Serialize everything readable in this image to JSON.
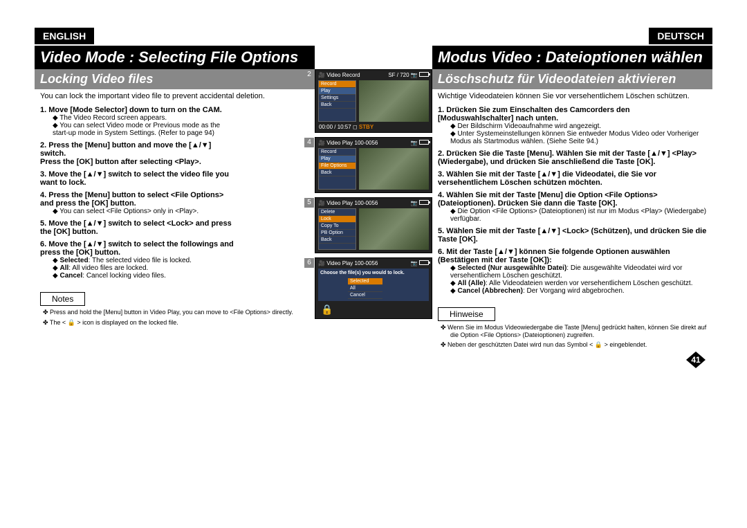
{
  "en": {
    "lang": "ENGLISH",
    "title": "Video Mode : Selecting File Options",
    "subtitle": "Locking Video files",
    "intro": "You can lock the important video file to prevent accidental deletion.",
    "steps": [
      {
        "n": "1.",
        "t": "Move [Mode Selector] down to turn on the CAM.",
        "subs": [
          "The Video Record screen appears.",
          "You can select Video mode or Previous mode as the start-up mode in System Settings. (Refer to page 94)"
        ]
      },
      {
        "n": "2.",
        "t": "Press the [Menu] button and move the [▲/▼] switch.",
        "t2": "Press the [OK] button after selecting <Play>."
      },
      {
        "n": "3.",
        "t": "Move the [▲/▼] switch to select the video file you want to lock."
      },
      {
        "n": "4.",
        "t": "Press the [Menu] button to select <File Options> and press the [OK] button.",
        "subs": [
          "You can select <File Options> only in <Play>."
        ]
      },
      {
        "n": "5.",
        "t": "Move the [▲/▼] switch to select <Lock> and press the [OK] button."
      },
      {
        "n": "6.",
        "t": "Move the [▲/▼] switch to select the followings and press the [OK] button.",
        "subs": [
          "Selected: The selected video file is locked.",
          "All: All video files are locked.",
          "Cancel: Cancel locking video files."
        ],
        "bold": [
          "Selected",
          "All",
          "Cancel"
        ]
      }
    ],
    "notes_label": "Notes",
    "notes": [
      "Press and hold the [Menu] button in Video Play, you can move to <File Options> directly.",
      "The < 🔒 > icon is displayed on the locked file."
    ]
  },
  "de": {
    "lang": "DEUTSCH",
    "title": "Modus Video : Dateioptionen wählen",
    "subtitle": "Löschschutz für Videodateien aktivieren",
    "intro": "Wichtige Videodateien können Sie vor versehentlichem Löschen schützen.",
    "steps": [
      {
        "n": "1.",
        "t": "Drücken Sie zum Einschalten des Camcorders den [Moduswahlschalter] nach unten.",
        "subs": [
          "Der Bildschirm Videoaufnahme wird angezeigt.",
          "Unter Systemeinstellungen können Sie entweder Modus Video oder Vorheriger Modus als Startmodus wählen. (Siehe Seite 94.)"
        ]
      },
      {
        "n": "2.",
        "t": "Drücken Sie die Taste [Menu]. Wählen Sie mit der Taste [▲/▼] <Play> (Wiedergabe), und drücken Sie anschließend die Taste [OK]."
      },
      {
        "n": "3.",
        "t": "Wählen Sie mit der Taste [▲/▼] die Videodatei, die Sie vor versehentlichem Löschen schützen möchten."
      },
      {
        "n": "4.",
        "t": "Wählen Sie mit der Taste [Menu] die Option <File Options> (Dateioptionen). Drücken Sie dann die Taste [OK].",
        "subs": [
          "Die Option <File Options> (Dateioptionen) ist nur im Modus <Play> (Wiedergabe) verfügbar."
        ]
      },
      {
        "n": "5.",
        "t": "Wählen Sie mit der Taste [▲/▼] <Lock> (Schützen), und drücken Sie die Taste [OK]."
      },
      {
        "n": "6.",
        "t": "Mit der Taste [▲/▼] können Sie folgende Optionen auswählen (Bestätigen mit der Taste [OK]):",
        "subs": [
          "Selected (Nur ausgewählte Datei): Die ausgewählte Videodatei wird vor versehentlichem Löschen geschützt.",
          "All (Alle): Alle Videodateien werden vor versehentlichem Löschen geschützt.",
          "Cancel (Abbrechen): Der Vorgang wird abgebrochen."
        ],
        "bold": [
          "Selected (Nur ausgewählte Datei)",
          "All (Alle)",
          "Cancel (Abbrechen)"
        ]
      }
    ],
    "notes_label": "Hinweise",
    "notes": [
      "Wenn Sie im Modus Videowiedergabe die Taste [Menu] gedrückt halten, können Sie direkt auf die Option <File Options> (Dateioptionen) zugreifen.",
      "Neben der geschützten Datei wird nun das Symbol < 🔒 > eingeblendet."
    ]
  },
  "screens": {
    "s2": {
      "num": "2",
      "title": "Video Record",
      "badge": "SF / 720",
      "menu": [
        "Record",
        "Play",
        "Settings",
        "Back"
      ],
      "hl": 0,
      "timer": "00:00 / 10:57",
      "stby": "STBY"
    },
    "s4": {
      "num": "4",
      "title": "Video Play",
      "file": "100-0056",
      "menu": [
        "Record",
        "Play",
        "File Options",
        "Back"
      ],
      "hl": 2
    },
    "s5": {
      "num": "5",
      "title": "Video Play",
      "file": "100-0056",
      "menu": [
        "Delete",
        "Lock",
        "Copy To",
        "PB Option",
        "Back"
      ],
      "hl": 1
    },
    "s6": {
      "num": "6",
      "title": "Video Play",
      "file": "100-0056",
      "prompt": "Choose the file(s) you would to lock.",
      "opts": [
        "Selected",
        "All",
        "Cancel"
      ],
      "hl": 0
    }
  },
  "page_number": "41"
}
